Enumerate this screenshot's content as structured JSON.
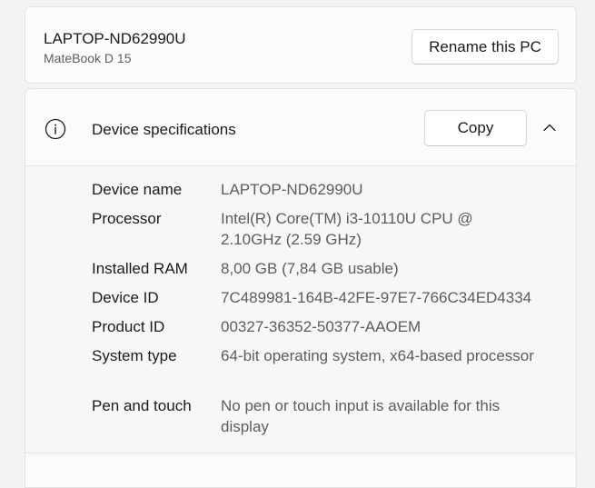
{
  "pc": {
    "name": "LAPTOP-ND62990U",
    "model": "MateBook D 15",
    "rename_label": "Rename this PC"
  },
  "specs": {
    "title": "Device specifications",
    "copy_label": "Copy",
    "icons": {
      "info": "info-circle-icon",
      "collapse": "chevron-up-icon"
    },
    "rows": [
      {
        "label": "Device name",
        "value": "LAPTOP-ND62990U"
      },
      {
        "label": "Processor",
        "value": "Intel(R) Core(TM) i3-10110U CPU @ 2.10GHz (2.59 GHz)"
      },
      {
        "label": "Installed RAM",
        "value": "8,00 GB (7,84 GB usable)"
      },
      {
        "label": "Device ID",
        "value": "7C489981-164B-42FE-97E7-766C34ED4334"
      },
      {
        "label": "Product ID",
        "value": "00327-36352-50377-AAOEM"
      },
      {
        "label": "System type",
        "value": "64-bit operating system, x64-based processor"
      },
      {
        "label": "Pen and touch",
        "value": "No pen or touch input is available for this display"
      }
    ]
  },
  "colors": {
    "background": "#f3f3f3",
    "card": "#fbfbfb",
    "value_text": "#5c5c5c"
  }
}
